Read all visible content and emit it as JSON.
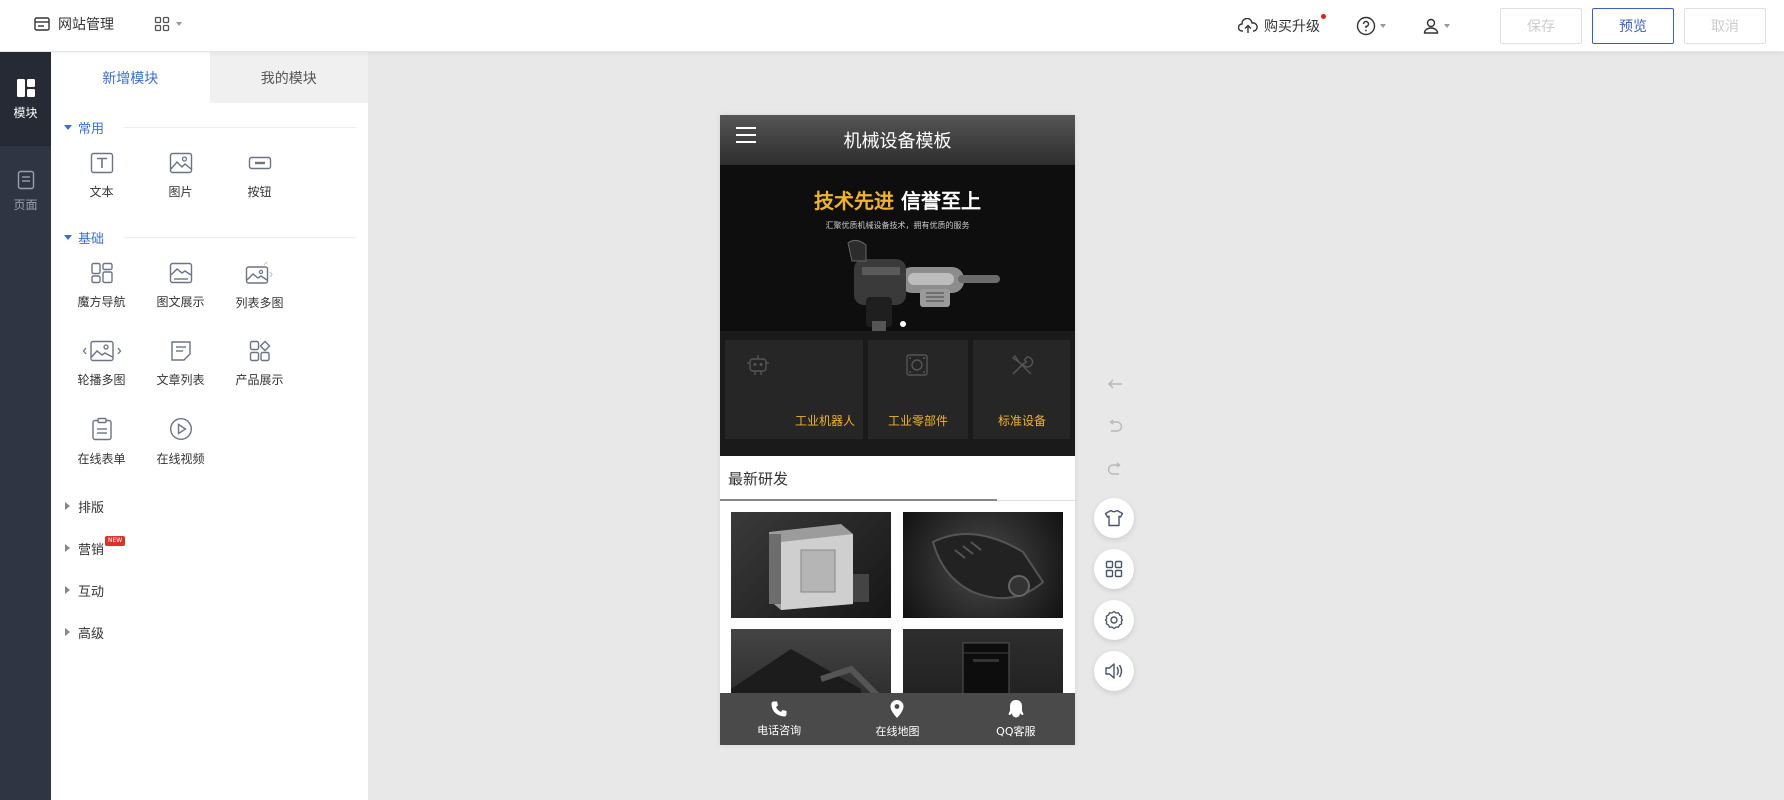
{
  "topbar": {
    "site_manage": "网站管理",
    "upgrade": "购买升级",
    "save": "保存",
    "preview": "预览",
    "cancel": "取消"
  },
  "rail": {
    "modules": "模块",
    "pages": "页面"
  },
  "panel": {
    "tabs": [
      "新增模块",
      "我的模块"
    ],
    "sections": {
      "common": {
        "title": "常用",
        "items": [
          "文本",
          "图片",
          "按钮"
        ]
      },
      "basic": {
        "title": "基础",
        "items": [
          "魔方导航",
          "图文展示",
          "列表多图",
          "轮播多图",
          "文章列表",
          "产品展示",
          "在线表单",
          "在线视频"
        ]
      },
      "layout": "排版",
      "marketing": "营销",
      "marketing_badge": "NEW",
      "interaction": "互动",
      "advanced": "高级"
    }
  },
  "phone": {
    "title": "机械设备模板",
    "slogan_gold": "技术先进",
    "slogan_white": "信誉至上",
    "subtitle": "汇聚优质机械设备技术，拥有优质的服务",
    "categories": [
      "工业机器人",
      "工业零部件",
      "标准设备"
    ],
    "section_title": "最新研发",
    "footer": [
      "电话咨询",
      "在线地图",
      "QQ客服"
    ]
  },
  "colors": {
    "accent": "#3a6fd8",
    "rail_bg": "#2f3542",
    "gold": "#f0b429"
  }
}
